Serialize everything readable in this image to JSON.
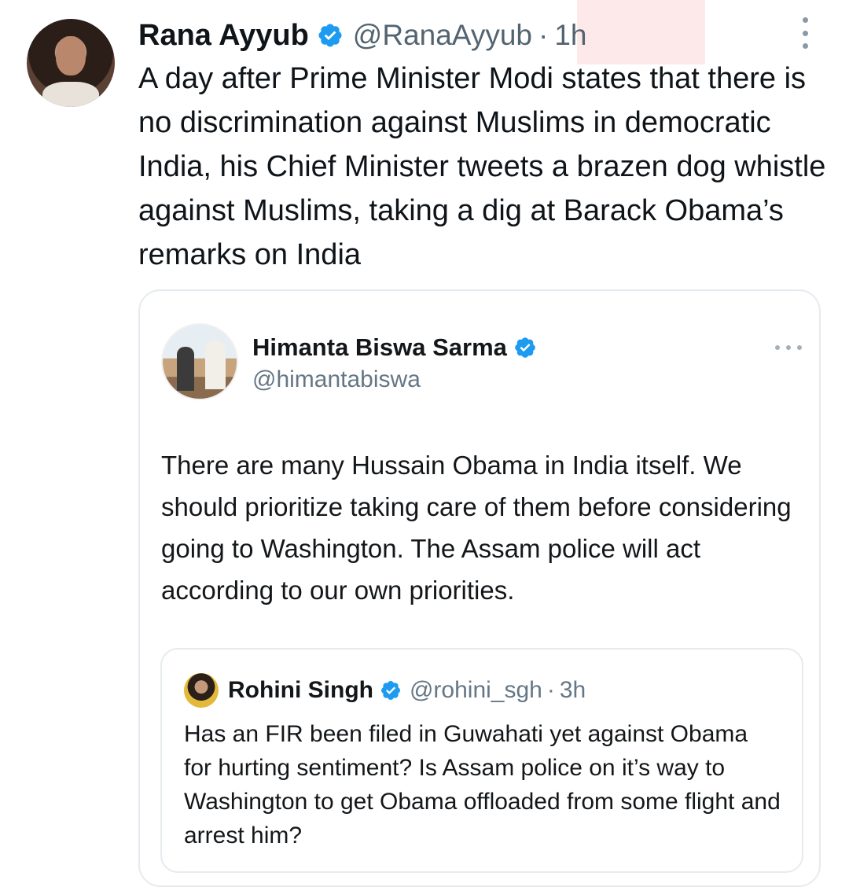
{
  "colors": {
    "verified_blue": "#1d9bf0",
    "secondary_text": "#536471",
    "border": "#e6ebef"
  },
  "tweet": {
    "author_name": "Rana Ayyub",
    "author_handle": "@RanaAyyub",
    "separator": "·",
    "time": "1h",
    "text": "A day after Prime Minister Modi states that there is no discrimination against Muslims in democratic India, his Chief Minister tweets a brazen dog whistle against Muslims, taking a dig at Barack Obama’s remarks on India"
  },
  "quoted_tweet": {
    "author_name": "Himanta Biswa Sarma",
    "author_handle": "@himantabiswa",
    "text": "There are many Hussain Obama in India itself. We should prioritize taking care of them before considering going to Washington. The Assam police will act according to our own priorities.",
    "nested_quote": {
      "author_name": "Rohini Singh",
      "author_handle": "@rohini_sgh",
      "separator": "·",
      "time": "3h",
      "text": "Has an FIR been filed in Guwahati yet against Obama for hurting sentiment? Is Assam police on it’s way to Washington to get Obama offloaded from some flight and arrest him?"
    }
  },
  "icons": {
    "verified": "verified-badge-icon",
    "more_vertical": "more-vertical-icon",
    "more_horizontal": "more-horizontal-icon"
  }
}
